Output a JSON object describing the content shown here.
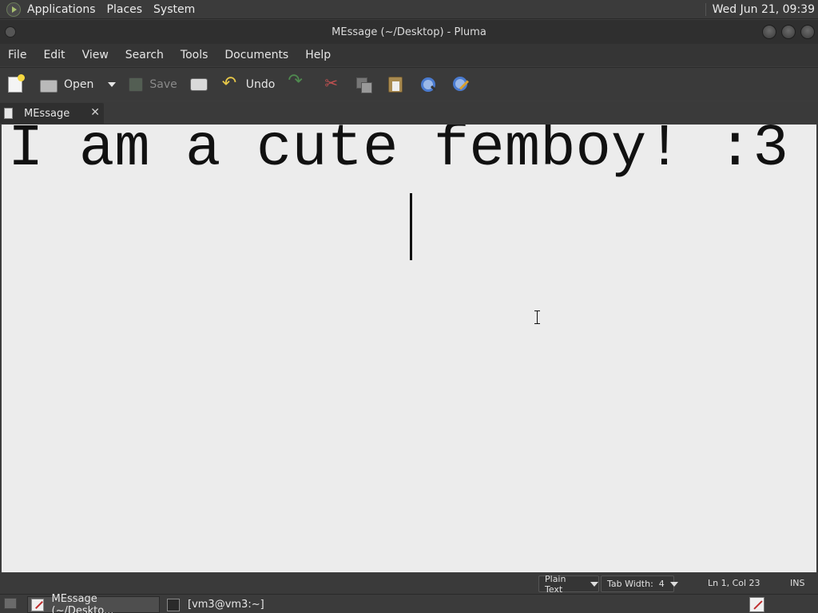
{
  "top_panel": {
    "menus": [
      "Applications",
      "Places",
      "System"
    ],
    "clock": "Wed Jun 21, 09:39"
  },
  "window": {
    "title": "MEssage (~/Desktop) - Pluma"
  },
  "menubar": [
    "File",
    "Edit",
    "View",
    "Search",
    "Tools",
    "Documents",
    "Help"
  ],
  "toolbar": {
    "new_icon": "new-document-icon",
    "open_label": "Open",
    "save_label": "Save",
    "undo_label": "Undo"
  },
  "tabs": [
    {
      "label": "MEssage"
    }
  ],
  "editor": {
    "text": "I am a cute femboy! :3"
  },
  "statusbar": {
    "language": "Plain Text",
    "tab_width": "Tab Width:  4",
    "position": "Ln 1, Col 23",
    "mode": "INS"
  },
  "taskbar": {
    "tasks": [
      "MEssage (~/Deskto...",
      "[vm3@vm3:~]"
    ]
  },
  "colors": {
    "panel": "#3b3b3b",
    "editor_bg": "#ececec",
    "text": "#111111"
  }
}
